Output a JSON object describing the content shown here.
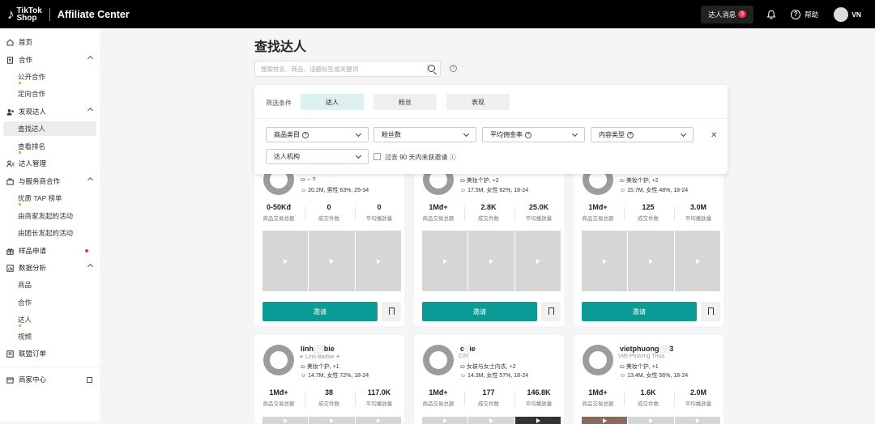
{
  "header": {
    "brand_line1": "TikTok",
    "brand_line2": "Shop",
    "title": "Affiliate Center",
    "msg_label": "达人消息",
    "msg_count": "5",
    "help": "帮助",
    "user": "VN"
  },
  "sidebar": {
    "items": [
      {
        "label": "首页",
        "icon": "home-icon"
      },
      {
        "label": "合作",
        "icon": "doc-icon"
      },
      {
        "label": "公开合作"
      },
      {
        "label": "定向合作"
      },
      {
        "label": "发现达人",
        "icon": "users-icon"
      },
      {
        "label": "查找达人"
      },
      {
        "label": "查看排名"
      },
      {
        "label": "达人管理",
        "icon": "user-manage-icon"
      },
      {
        "label": "与服务商合作",
        "icon": "partner-icon"
      },
      {
        "label": "优质 TAP 榜单"
      },
      {
        "label": "由商家发起的活动"
      },
      {
        "label": "由团长发起的活动"
      },
      {
        "label": "样品申请",
        "icon": "gift-icon"
      },
      {
        "label": "数据分析",
        "icon": "chart-icon"
      },
      {
        "label": "商品"
      },
      {
        "label": "合作"
      },
      {
        "label": "达人"
      },
      {
        "label": "视频"
      },
      {
        "label": "联盟订单",
        "icon": "order-icon"
      },
      {
        "label": "商家中心",
        "icon": "store-icon"
      }
    ]
  },
  "page": {
    "title": "查找达人",
    "search_placeholder": "搜索姓名、商品、话题标签或关键词"
  },
  "filters": {
    "label": "筛选条件",
    "tabs": [
      "达人",
      "粉丝",
      "表现"
    ],
    "dropdowns": [
      "商品类目",
      "粉丝数",
      "平均佣金率",
      "内容类型",
      "达人机构"
    ],
    "checkbox": "过去 90 天内未获邀请"
  },
  "stat_labels": [
    "商品交易总额",
    "成交件数",
    "平均播放量"
  ],
  "invite_label": "邀请",
  "cards": [
    {
      "line1": "--",
      "line2": "20.2M, 男性 63%, 25-34",
      "gmv": "0-50Kđ",
      "sold": "0",
      "views": "0"
    },
    {
      "line1": "美妆个护, +2",
      "line2": "17.5M, 女性 62%, 18-24",
      "gmv": "1Mđ+",
      "sold": "2.8K",
      "views": "25.0K"
    },
    {
      "line1": "美妆个护, +2",
      "line2": "15.7M, 女性 48%, 18-24",
      "gmv": "1Mđ+",
      "sold": "125",
      "views": "3.0M"
    },
    {
      "name": "linh",
      "name_tail": "bie",
      "alias": "Linh Barbie",
      "line1": "美妆个护, +1",
      "line2": "14.7M, 女性 72%, 18-24",
      "gmv": "1Mđ+",
      "sold": "38",
      "views": "117.0K"
    },
    {
      "name": "c",
      "name_tail": "ie",
      "alias": "CIN",
      "line1": "女装与女士内衣, +2",
      "line2": "14.3M, 女性 57%, 18-24",
      "gmv": "1Mđ+",
      "sold": "177",
      "views": "146.8K"
    },
    {
      "name": "vietphuong",
      "name_tail": "3",
      "alias": "Việt Phương Thoa",
      "line1": "美妆个护, +1",
      "line2": "13.4M, 女性 56%, 18-24",
      "gmv": "1Mđ+",
      "sold": "1.6K",
      "views": "2.0M"
    }
  ]
}
